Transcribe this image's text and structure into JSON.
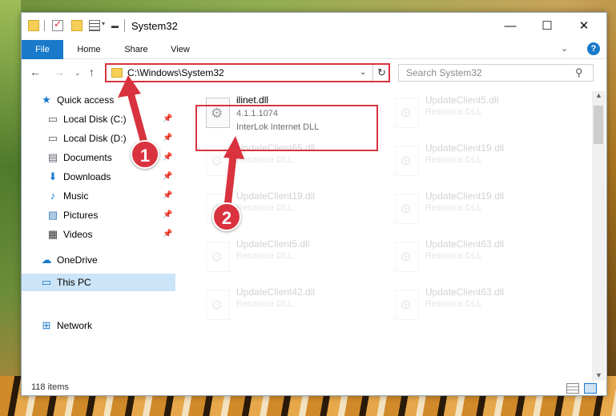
{
  "window": {
    "title": "System32",
    "controls": {
      "minimize": "—",
      "maximize": "☐",
      "close": "✕"
    }
  },
  "ribbon": {
    "tabs": [
      "File",
      "Home",
      "Share",
      "View"
    ],
    "expand": "⌄",
    "help": "?"
  },
  "nav": {
    "back": "←",
    "forward": "→",
    "recent": "⌄",
    "up": "↑",
    "address": "C:\\Windows\\System32",
    "address_dropdown": "⌄",
    "refresh": "↻",
    "search_placeholder": "Search System32",
    "search_icon": "⚲"
  },
  "sidebar": {
    "items": [
      {
        "label": "Quick access",
        "icon": "★",
        "pinned": false
      },
      {
        "label": "Local Disk (C:)",
        "icon": "▭",
        "pinned": true
      },
      {
        "label": "Local Disk (D:)",
        "icon": "▭",
        "pinned": true
      },
      {
        "label": "Documents",
        "icon": "▤",
        "pinned": true
      },
      {
        "label": "Downloads",
        "icon": "⬇",
        "pinned": true
      },
      {
        "label": "Music",
        "icon": "♪",
        "pinned": true
      },
      {
        "label": "Pictures",
        "icon": "▨",
        "pinned": true
      },
      {
        "label": "Videos",
        "icon": "▦",
        "pinned": true
      },
      {
        "label": "OneDrive",
        "icon": "☁",
        "pinned": false
      },
      {
        "label": "This PC",
        "icon": "▭",
        "pinned": false,
        "selected": true
      },
      {
        "label": "Network",
        "icon": "⊞",
        "pinned": false
      }
    ],
    "pin_glyph": "📌"
  },
  "files": [
    {
      "name": "ilinet.dll",
      "version": "4.1.1.1074",
      "description": "InterLok Internet DLL",
      "highlighted": true
    },
    {
      "name": "UpdateClient5.dll",
      "description": "Resource DLL"
    },
    {
      "name": "UpdateClient65.dll",
      "description": "Resource DLL"
    },
    {
      "name": "UpdateClient19.dll",
      "description": "Resource DLL"
    },
    {
      "name": "UpdateClient19.dll",
      "description": "Resource DLL"
    },
    {
      "name": "UpdateClient19.dll",
      "description": "Resource DLL"
    },
    {
      "name": "UpdateClient5.dll",
      "description": "Resource DLL"
    },
    {
      "name": "UpdateClient63.dll",
      "description": "Resource DLL"
    },
    {
      "name": "UpdateClient42.dll",
      "description": "Resource DLL"
    },
    {
      "name": "UpdateClient63.dll",
      "description": "Resource DLL"
    }
  ],
  "status": {
    "item_count": "118 items"
  },
  "callouts": [
    "1",
    "2"
  ],
  "colors": {
    "accent": "#1979ca",
    "highlight": "#d9333f",
    "selected": "#cce4f7"
  }
}
